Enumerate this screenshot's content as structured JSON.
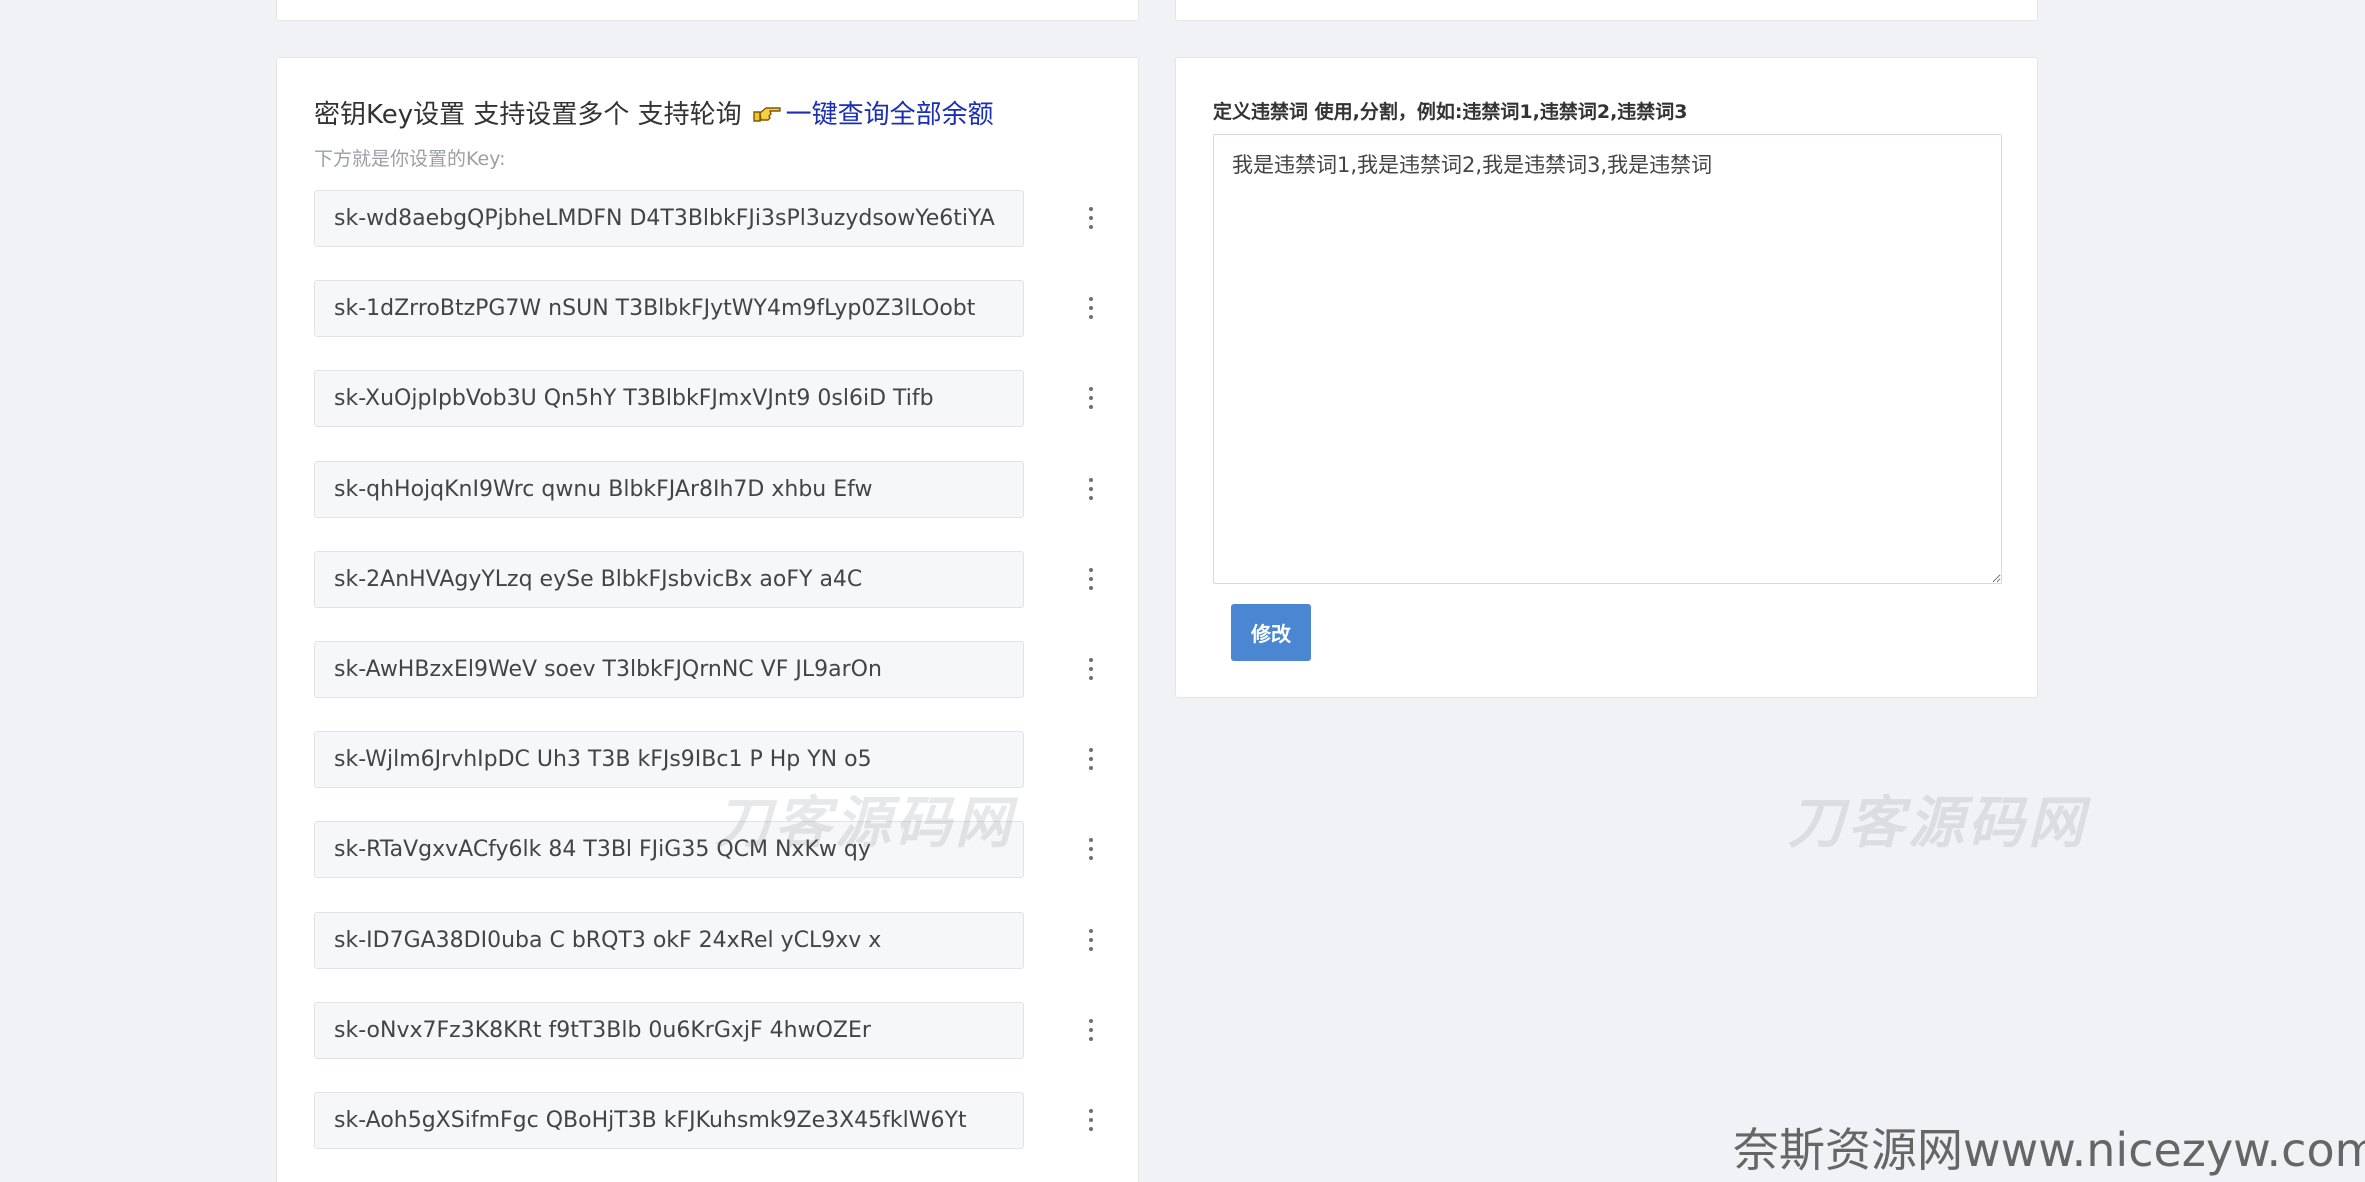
{
  "key_panel": {
    "title": "密钥Key设置 支持设置多个 支持轮询",
    "link_label": "一键查询全部余额",
    "subtitle": "下方就是你设置的Key:",
    "keys": [
      "sk-wd8aebgQPjbheLMDFN D4T3BlbkFJi3sPl3uzydsowYe6tiYA",
      "sk-1dZrroBtzPG7W   nSUN   T3BlbkFJytWY4m9fLyp0Z3lLOobt",
      "sk-XuOjpIpbVob3U   Qn5hY   T3BlbkFJmxVJnt9   0sl6iD   Tifb",
      "sk-qhHojqKnI9Wrc   qwnu    BlbkFJAr8Ih7D   xhbu   Efw",
      "sk-2AnHVAgyYLzq   eySe    BlbkFJsbvicBx   aoFY   a4C",
      "sk-AwHBzxEl9WeV   soev   T3lbkFJQrnNC   VF   JL9arOn",
      "sk-Wjlm6JrvhIpDC   Uh3   T3B   kFJs9IBc1   P   Hp   YN   o5",
      "sk-RTaVgxvACfy6lk   84   T3Bl   FJiG35   QCM   NxKw   qy",
      "sk-ID7GA38DI0uba   C   bRQT3   okF   24xRel   yCL9xv   x",
      "sk-oNvx7Fz3K8KRt   f9tT3Blb   0u6KrGxjF   4hwOZEr",
      "sk-Aoh5gXSifmFgc   QBoHjT3B   kFJKuhsmk9Ze3X45fklW6Yt",
      ""
    ]
  },
  "ban_panel": {
    "label": "定义违禁词 使用,分割，例如:违禁词1,违禁词2,违禁词3",
    "value": "我是违禁词1,我是违禁词2,我是违禁词3,我是违禁词",
    "button_label": "修改"
  },
  "watermarks": {
    "left": "刀客源码网",
    "right": "刀客源码网",
    "bottom": "奈斯资源网www.nicezyw.com"
  },
  "colors": {
    "link": "#1a2fb3",
    "button": "#4a86d1",
    "page_bg": "#f1f2f5"
  }
}
